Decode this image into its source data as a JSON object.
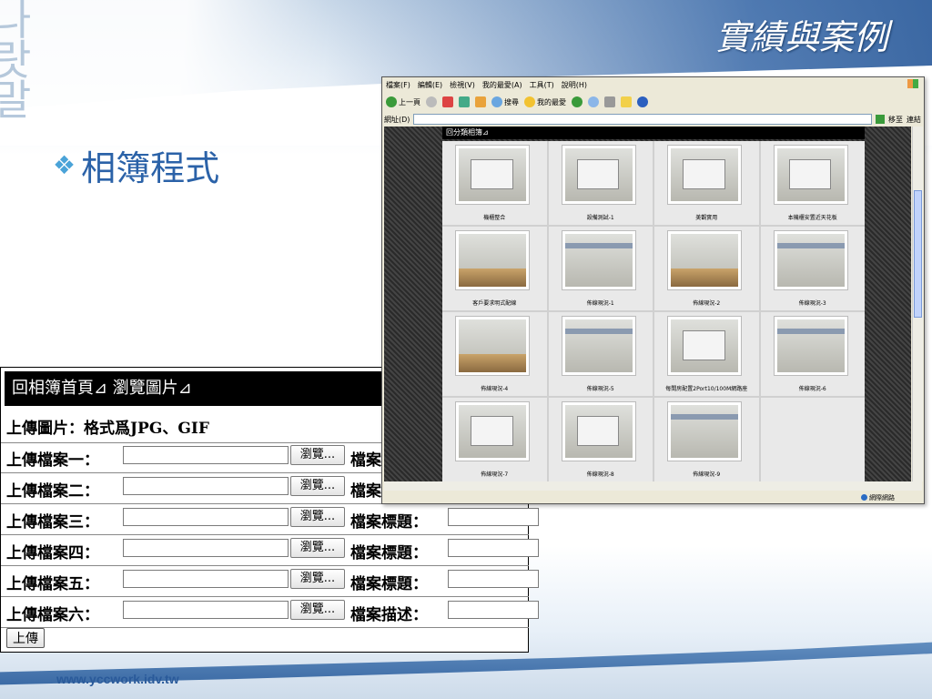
{
  "slide": {
    "title": "實績與案例",
    "bullet_text": "相簿程式",
    "footer_url": "www.yccwork.idv.tw",
    "deco_text": "나\n랏\n말"
  },
  "upload_form": {
    "header": "回相簿首頁⊿  瀏覽圖片⊿",
    "format_note": "上傳圖片：格式爲JPG、GIF",
    "browse_label": "瀏覽...",
    "rows": [
      {
        "label": "上傳檔案一：",
        "field_label": "檔案標題："
      },
      {
        "label": "上傳檔案二：",
        "field_label": "檔案標題："
      },
      {
        "label": "上傳檔案三：",
        "field_label": "檔案標題："
      },
      {
        "label": "上傳檔案四：",
        "field_label": "檔案標題："
      },
      {
        "label": "上傳檔案五：",
        "field_label": "檔案標題："
      },
      {
        "label": "上傳檔案六：",
        "field_label": "檔案描述："
      }
    ],
    "submit_label": "上傳"
  },
  "browser": {
    "menu": [
      "檔案(F)",
      "編輯(E)",
      "檢視(V)",
      "我的最愛(A)",
      "工具(T)",
      "說明(H)"
    ],
    "toolbar": [
      "上一頁",
      "搜尋",
      "我的最愛"
    ],
    "address_label": "網址(D)",
    "go_label": "移至",
    "links_label": "連結",
    "status": "網際網路",
    "album_title": "回分類相簿⊿",
    "photos": [
      {
        "caption": "機櫃整合",
        "kind": "box"
      },
      {
        "caption": "設備測試-1",
        "kind": "box"
      },
      {
        "caption": "美觀實用",
        "kind": "box"
      },
      {
        "caption": "本機櫃安置近天花板",
        "kind": "box"
      },
      {
        "caption": "客戶要求明式配線",
        "kind": "room"
      },
      {
        "caption": "佈線現況-1",
        "kind": "wall"
      },
      {
        "caption": "佈線現況-2",
        "kind": "room"
      },
      {
        "caption": "佈線現況-3",
        "kind": "wall"
      },
      {
        "caption": "佈線現況-4",
        "kind": "room"
      },
      {
        "caption": "佈線現況-5",
        "kind": "wall"
      },
      {
        "caption": "每間房配置2Port10/100M網路座",
        "kind": "box"
      },
      {
        "caption": "佈線現況-6",
        "kind": "wall"
      },
      {
        "caption": "佈線現況-7",
        "kind": "box"
      },
      {
        "caption": "佈線現況-8",
        "kind": "box"
      },
      {
        "caption": "佈線現況-9",
        "kind": "wall"
      }
    ]
  },
  "colors": {
    "title_blue": "#2b62a8",
    "accent_blue": "#2a5a9a",
    "bullet_icon": "#4aa3d8"
  },
  "icons": {
    "bullet": "diamond-bullet-icon"
  }
}
